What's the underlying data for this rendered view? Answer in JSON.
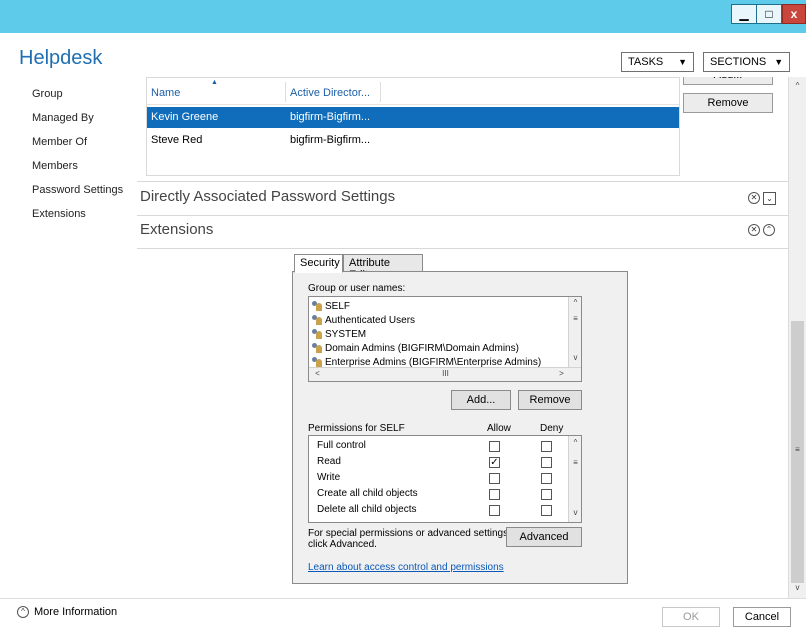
{
  "window": {
    "minimize_glyph": "▁",
    "maximize_glyph": "□",
    "close_glyph": "x"
  },
  "header": {
    "title": "Helpdesk",
    "tasks_label": "TASKS",
    "sections_label": "SECTIONS",
    "dropdown_arrow": "▼"
  },
  "nav": {
    "items": [
      "Group",
      "Managed By",
      "Member Of",
      "Members",
      "Password Settings",
      "Extensions"
    ]
  },
  "members": {
    "columns": {
      "name": "Name",
      "ad": "Active Director...",
      "sort_glyph": "▲"
    },
    "rows": [
      {
        "name": "Kevin Greene",
        "ad": "bigfirm-Bigfirm...",
        "selected": true
      },
      {
        "name": "Steve Red",
        "ad": "bigfirm-Bigfirm...",
        "selected": false
      }
    ],
    "add_label": "Add...",
    "remove_label": "Remove"
  },
  "sections": {
    "password_settings": {
      "title": "Directly Associated Password Settings",
      "close_glyph": "✕",
      "toggle_glyph": "⌄"
    },
    "extensions": {
      "title": "Extensions",
      "close_glyph": "✕",
      "toggle_glyph": "⌃"
    }
  },
  "security": {
    "tabs": [
      "Security",
      "Attribute Editor"
    ],
    "group_label": "Group or user names:",
    "groups": [
      "SELF",
      "Authenticated Users",
      "SYSTEM",
      "Domain Admins (BIGFIRM\\Domain Admins)",
      "Enterprise Admins (BIGFIRM\\Enterprise Admins)"
    ],
    "add_label": "Add...",
    "remove_label": "Remove",
    "permissions_label": "Permissions for SELF",
    "allow_label": "Allow",
    "deny_label": "Deny",
    "permissions": [
      {
        "name": "Full control",
        "allow": false,
        "deny": false
      },
      {
        "name": "Read",
        "allow": true,
        "deny": false
      },
      {
        "name": "Write",
        "allow": false,
        "deny": false
      },
      {
        "name": "Create all child objects",
        "allow": false,
        "deny": false
      },
      {
        "name": "Delete all child objects",
        "allow": false,
        "deny": false
      }
    ],
    "advanced_text_1": "For special permissions or advanced settings,",
    "advanced_text_2": "click Advanced.",
    "advanced_label": "Advanced",
    "link_text": "Learn about access control and permissions",
    "hscroll_thumb_glyph": "III",
    "check_glyph": "✓"
  },
  "footer": {
    "more_info_label": "More Information",
    "ok_label": "OK",
    "cancel_label": "Cancel"
  }
}
